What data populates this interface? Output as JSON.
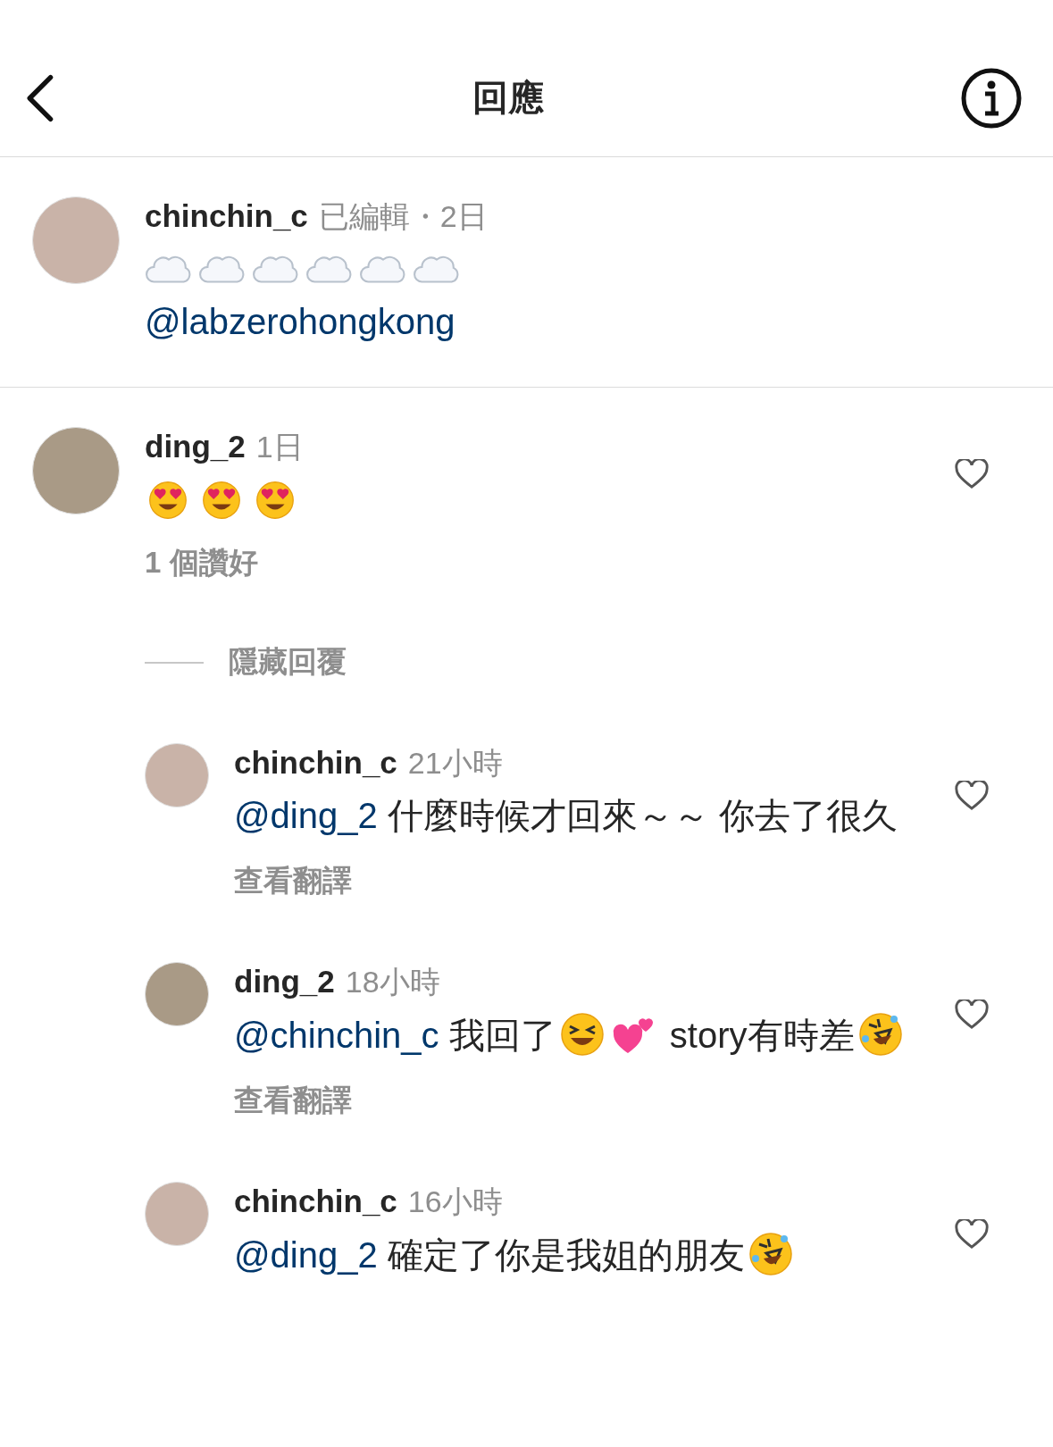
{
  "header": {
    "title": "回應"
  },
  "caption": {
    "username": "chinchin_c",
    "meta": "已編輯・2日",
    "lines": [
      [
        {
          "kind": "cloud"
        },
        {
          "kind": "cloud"
        },
        {
          "kind": "cloud"
        },
        {
          "kind": "cloud"
        },
        {
          "kind": "cloud"
        },
        {
          "kind": "cloud"
        }
      ],
      [
        {
          "kind": "mention",
          "text": "@labzerohongkong"
        }
      ]
    ]
  },
  "comments": [
    {
      "username": "ding_2",
      "time": "1日",
      "liked": false,
      "content": [
        {
          "kind": "heart-eyes"
        },
        {
          "kind": "heart-eyes"
        },
        {
          "kind": "heart-eyes"
        }
      ],
      "likes": "1 個讚好",
      "hide_replies": "隱藏回覆",
      "replies": [
        {
          "username": "chinchin_c",
          "time": "21小時",
          "liked": false,
          "content": [
            {
              "kind": "mention",
              "text": "@ding_2"
            },
            {
              "kind": "text",
              "text": " 什麼時候才回來～～ 你去了很久"
            }
          ],
          "translate": "查看翻譯"
        },
        {
          "username": "ding_2",
          "time": "18小時",
          "liked": false,
          "content": [
            {
              "kind": "mention",
              "text": "@chinchin_c"
            },
            {
              "kind": "text",
              "text": " 我回了"
            },
            {
              "kind": "grin"
            },
            {
              "kind": "hearts"
            },
            {
              "kind": "text",
              "text": " story有時差"
            },
            {
              "kind": "rofl"
            }
          ],
          "translate": "查看翻譯"
        },
        {
          "username": "chinchin_c",
          "time": "16小時",
          "liked": false,
          "content": [
            {
              "kind": "mention",
              "text": "@ding_2"
            },
            {
              "kind": "text",
              "text": " 確定了你是我姐的朋友"
            },
            {
              "kind": "rofl"
            }
          ]
        }
      ]
    }
  ]
}
